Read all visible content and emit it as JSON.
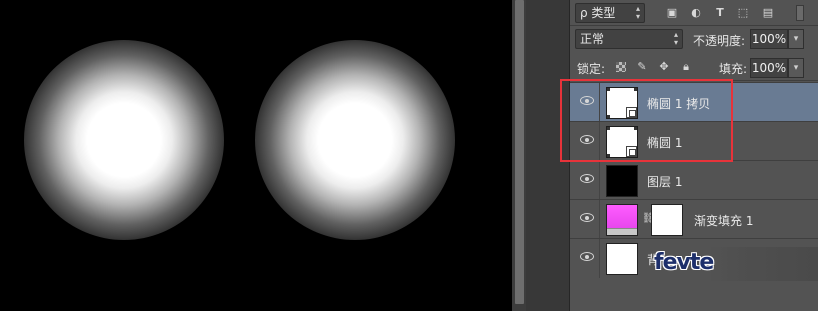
{
  "panel": {
    "filter": {
      "value": "ρ 类型"
    },
    "blend": {
      "mode": "正常",
      "opacity_label": "不透明度:",
      "opacity_value": "100%"
    },
    "lock": {
      "label": "锁定:",
      "fill_label": "填充:",
      "fill_value": "100%"
    },
    "layers": [
      {
        "name": "椭圆 1 拷贝",
        "selected": true
      },
      {
        "name": "椭圆 1",
        "selected": false
      },
      {
        "name": "图层 1",
        "selected": false
      },
      {
        "name": "渐变填充 1",
        "selected": false
      },
      {
        "name": "背",
        "selected": false
      }
    ]
  },
  "watermark": {
    "text": "fevte"
  },
  "colors": {
    "panel_bg": "#535353",
    "selected_row": "#697b93",
    "highlight": "#e8333a",
    "canvas": "#000000"
  },
  "icons": [
    "search-icon",
    "pixel-filter-icon",
    "adjustment-filter-icon",
    "type-filter-icon",
    "shape-filter-icon",
    "smart-object-filter-icon",
    "filter-toggle-icon",
    "lock-transparent-icon",
    "lock-paint-icon",
    "lock-move-icon",
    "lock-all-icon",
    "eye-icon",
    "link-icon"
  ]
}
